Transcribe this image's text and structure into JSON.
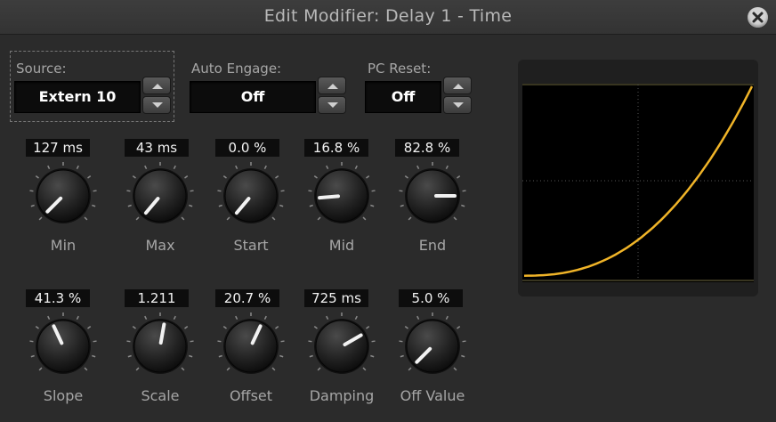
{
  "window": {
    "title": "Edit Modifier: Delay 1 - Time"
  },
  "source": {
    "label": "Source:",
    "value": "Extern 10"
  },
  "auto_engage": {
    "label": "Auto Engage:",
    "value": "Off"
  },
  "pc_reset": {
    "label": "PC Reset:",
    "value": "Off"
  },
  "knobs": [
    {
      "label": "Min",
      "display": "127 ms",
      "angle": -135
    },
    {
      "label": "Max",
      "display": "43 ms",
      "angle": -140
    },
    {
      "label": "Start",
      "display": "0.0 %",
      "angle": -140
    },
    {
      "label": "Mid",
      "display": "16.8 %",
      "angle": -95
    },
    {
      "label": "End",
      "display": "82.8 %",
      "angle": 90
    },
    {
      "label": "Slope",
      "display": "41.3 %",
      "angle": -25
    },
    {
      "label": "Scale",
      "display": "1.211",
      "angle": 10
    },
    {
      "label": "Offset",
      "display": "20.7 %",
      "angle": 25
    },
    {
      "label": "Damping",
      "display": "725 ms",
      "angle": 60
    },
    {
      "label": "Off Value",
      "display": "5.0 %",
      "angle": -135
    }
  ],
  "colors": {
    "curve": "#f0b428",
    "grid": "#6f6a3f",
    "background": "#2b2b2b"
  }
}
